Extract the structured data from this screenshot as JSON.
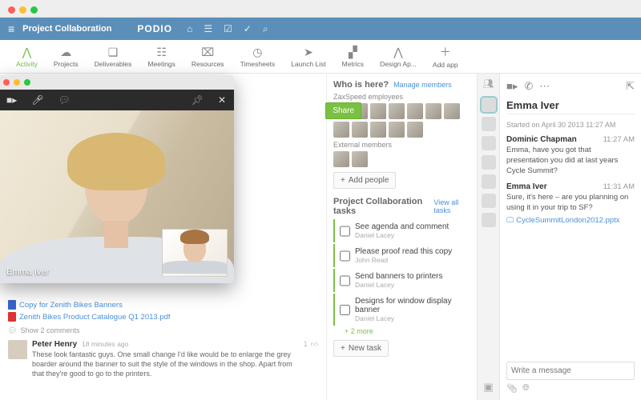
{
  "workspace_title": "Project Collaboration",
  "product": "PODIO",
  "apps": [
    {
      "label": "Activity",
      "active": true
    },
    {
      "label": "Projects"
    },
    {
      "label": "Deliverables"
    },
    {
      "label": "Meetings"
    },
    {
      "label": "Resources"
    },
    {
      "label": "Timesheets"
    },
    {
      "label": "Launch List"
    },
    {
      "label": "Metrics"
    },
    {
      "label": "Design Ap..."
    },
    {
      "label": "Add app"
    }
  ],
  "share_label": "Share",
  "video": {
    "caller": "Emma Iver"
  },
  "feed": {
    "file1": "Copy for Zenith Bikes Banners",
    "file2": "Zenith Bikes Product Catalogue Q1 2013.pdf",
    "show_comments": "Show 2 comments",
    "comment": {
      "author": "Peter Henry",
      "time": "18 minutes ago",
      "text": "These look fantastic guys. One small change I'd like would be to enlarge the grey boarder around the banner to suit the style of the windows in the shop. Apart from that they're good to go to the printers.",
      "likes": "1"
    }
  },
  "who": {
    "title": "Who is here?",
    "manage": "Manage members",
    "group": "ZaxSpeed employees",
    "external": "External members",
    "add": "Add people"
  },
  "tasks": {
    "title": "Project Collaboration tasks",
    "view_all": "View all tasks",
    "items": [
      {
        "t": "See agenda and comment",
        "a": "Daniel Lacey"
      },
      {
        "t": "Please proof read this copy",
        "a": "John Read"
      },
      {
        "t": "Send banners to printers",
        "a": "Daniel Lacey"
      },
      {
        "t": "Designs for window display banner",
        "a": "Daniel Lacey"
      }
    ],
    "more": "+ 2 more",
    "new": "New task"
  },
  "chat": {
    "name": "Emma Iver",
    "started": "Started on April 30 2013 11:27 AM",
    "messages": [
      {
        "author": "Dominic Chapman",
        "time": "11:27 AM",
        "text": "Emma, have you got that presentation you did at last years Cycle Summit?"
      },
      {
        "author": "Emma Iver",
        "time": "11:31 AM",
        "text": "Sure, it's here – are you planning on using it in your trip to SF?",
        "attachment": "CycleSummitLondon2012.pptx"
      }
    ],
    "placeholder": "Write a message"
  }
}
